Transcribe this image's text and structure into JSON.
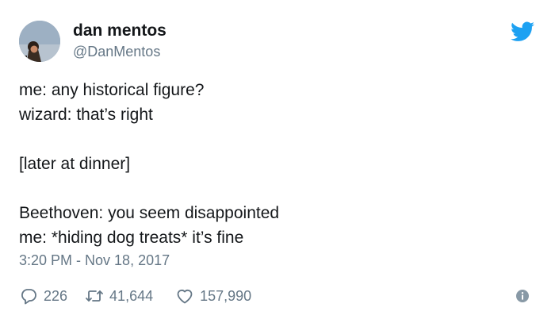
{
  "author": {
    "display_name": "dan mentos",
    "handle": "@DanMentos"
  },
  "tweet": {
    "lines": [
      "me: any historical figure?",
      "wizard: that’s right",
      "",
      "[later at dinner]",
      "",
      "Beethoven: you seem disappointed",
      "me: *hiding dog treats* it’s fine"
    ],
    "timestamp": "3:20 PM - Nov 18, 2017"
  },
  "actions": {
    "reply_count": "226",
    "retweet_count": "41,644",
    "like_count": "157,990"
  },
  "icons": {
    "brand": "twitter-bird-icon",
    "reply": "reply-icon",
    "retweet": "retweet-icon",
    "like": "heart-icon",
    "info": "info-icon"
  },
  "colors": {
    "twitter_blue": "#1da1f2",
    "text_primary": "#14171a",
    "text_secondary": "#657786"
  }
}
